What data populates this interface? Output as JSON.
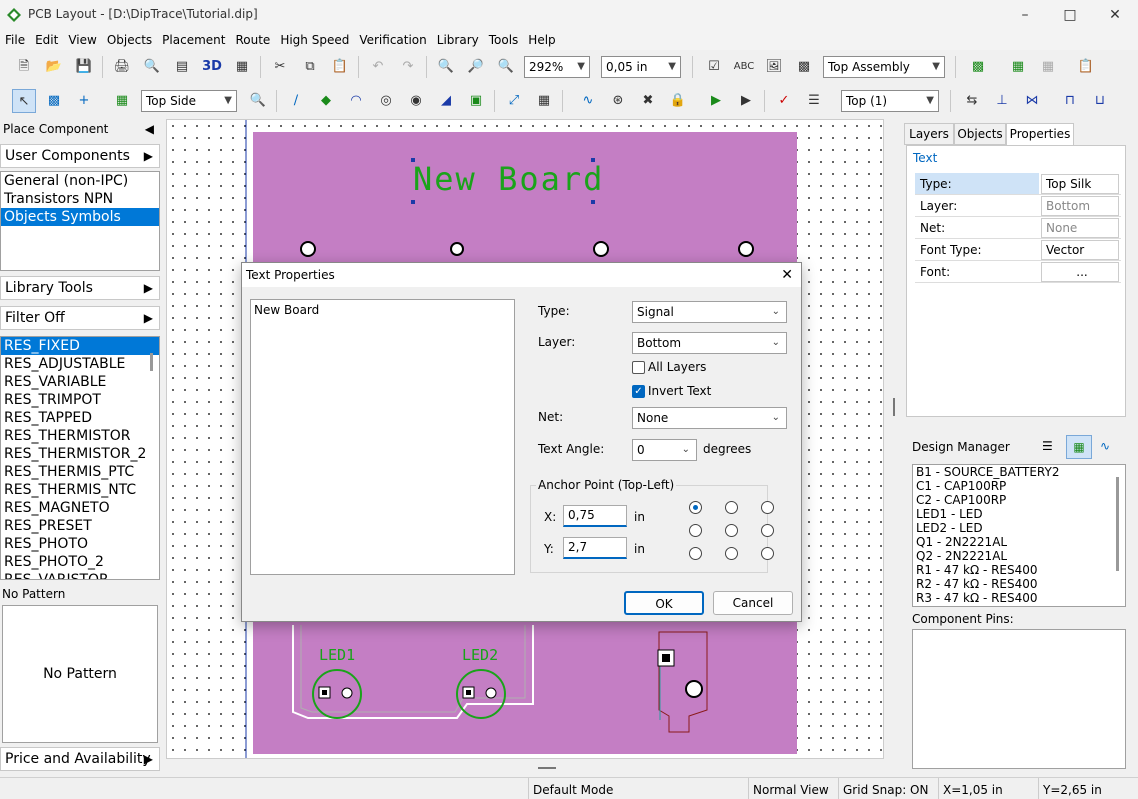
{
  "window": {
    "title": "PCB Layout - [D:\\DipTrace\\Tutorial.dip]"
  },
  "menu": [
    "File",
    "Edit",
    "View",
    "Objects",
    "Placement",
    "Route",
    "High Speed",
    "Verification",
    "Library",
    "Tools",
    "Help"
  ],
  "toolbar1": {
    "zoom": "292%",
    "grid": "0,05 in",
    "view_mode": "Top Assembly"
  },
  "toolbar2": {
    "side": "Top Side",
    "layer": "Top (1)"
  },
  "left_panel": {
    "place_component": "Place Component",
    "user_components": "User Components",
    "libraries": [
      "General (non-IPC)",
      "Transistors NPN",
      "Objects Symbols"
    ],
    "library_tools": "Library Tools",
    "filter": "Filter Off",
    "components": [
      "RES_FIXED",
      "RES_ADJUSTABLE",
      "RES_VARIABLE",
      "RES_TRIMPOT",
      "RES_TAPPED",
      "RES_THERMISTOR",
      "RES_THERMISTOR_2",
      "RES_THERMIS_PTC",
      "RES_THERMIS_NTC",
      "RES_MAGNETO",
      "RES_PRESET",
      "RES_PHOTO",
      "RES_PHOTO_2",
      "RES_VARISTOR"
    ],
    "pattern_header": "No Pattern",
    "pattern_preview": "No Pattern",
    "price": "Price and Availability"
  },
  "board": {
    "title_text": "New Board",
    "labels": [
      "LED1",
      "LED2"
    ]
  },
  "right_panel": {
    "tabs": [
      "Layers",
      "Objects",
      "Properties"
    ],
    "section": "Text",
    "props": [
      {
        "key": "Type:",
        "value": "Top Silk"
      },
      {
        "key": "Layer:",
        "value": "Bottom"
      },
      {
        "key": "Net:",
        "value": "None"
      },
      {
        "key": "Font Type:",
        "value": "Vector"
      },
      {
        "key": "Font:",
        "value": "..."
      }
    ],
    "design_manager": "Design Manager",
    "components": [
      "B1 - SOURCE_BATTERY2",
      "C1 - CAP100RP",
      "C2 - CAP100RP",
      "LED1 - LED",
      "LED2 - LED",
      "Q1 - 2N2221AL",
      "Q2 - 2N2221AL",
      "R1 - 47 kΩ - RES400",
      "R2 - 47 kΩ - RES400",
      "R3 - 47 kΩ - RES400"
    ],
    "component_pins": "Component Pins:"
  },
  "dialog": {
    "title": "Text Properties",
    "text": "New Board",
    "type_label": "Type:",
    "type_value": "Signal",
    "layer_label": "Layer:",
    "layer_value": "Bottom",
    "all_layers": "All Layers",
    "invert_text": "Invert Text",
    "net_label": "Net:",
    "net_value": "None",
    "angle_label": "Text Angle:",
    "angle_value": "0",
    "degrees": "degrees",
    "anchor_group": "Anchor Point (Top-Left)",
    "x_label": "X:",
    "x_value": "0,75",
    "x_unit": "in",
    "y_label": "Y:",
    "y_value": "2,7",
    "y_unit": "in",
    "ok": "OK",
    "cancel": "Cancel"
  },
  "status": {
    "mode": "Default Mode",
    "view": "Normal View",
    "snap": "Grid Snap: ON",
    "x": "X=1,05 in",
    "y": "Y=2,65 in"
  },
  "colors": {
    "board": "#c47ec4",
    "silk": "#1aa31a",
    "accent": "#0078d7"
  }
}
